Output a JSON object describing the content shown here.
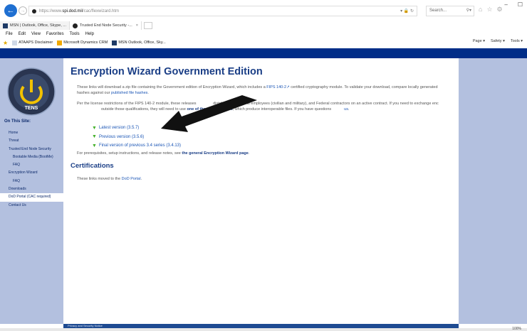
{
  "browser": {
    "url_prefix": "https://www.",
    "url_host": "spi.dod.mil",
    "url_path": "/cac/flexwizard.htm",
    "search_placeholder": "Search...",
    "tabs": [
      {
        "label": "MSN | Outlook, Office, Skype, ..."
      },
      {
        "label": "Trusted End Node Security -..."
      }
    ],
    "menu": [
      "File",
      "Edit",
      "View",
      "Favorites",
      "Tools",
      "Help"
    ],
    "favorites": [
      "ATAAPS Disclaimer",
      "Microsoft Dynamics CRM",
      "MSN Outlook, Office, Sky..."
    ],
    "toolbar_right": [
      "Page ▾",
      "Safety ▾",
      "Tools ▾"
    ],
    "zoom": "100%"
  },
  "sidebar": {
    "heading": "On This Site:",
    "items": [
      {
        "label": "Home"
      },
      {
        "label": "Threat"
      },
      {
        "label": "Trusted End Node Security"
      },
      {
        "label": "Bootable Media (BootMe)"
      },
      {
        "label": "FAQ"
      },
      {
        "label": "Encryption Wizard"
      },
      {
        "label": "FAQ"
      },
      {
        "label": "Downloads"
      },
      {
        "label": "DoD Portal (CAC required)"
      },
      {
        "label": "Contact Us"
      }
    ]
  },
  "main": {
    "title": "Encryption Wizard Government Edition",
    "intro": {
      "t1": "These links will download a zip file containing the Government edition of Encryption Wizard, which includes a ",
      "fips_link": "FIPS 140-2",
      "t2": " certified cryptography module. To validate your download, compare locally generated hashes against our ",
      "hashes_link": "published file hashes",
      "t3": "."
    },
    "license": {
      "t1": "Per the license restrictions of the FIPS 140-2 module, these releases ",
      "t2": "distributed to Federal employees (civilian and military), and Federal contractors on an active contract. If you need to exchange enc",
      "t3": "outside those qualifications, they will need to use ",
      "other_link": "one of the other editions",
      "t4": ", which produce interoperable files. If you have questions",
      "us_link": "us"
    },
    "versions": [
      {
        "label": "Latest version (3.5.7)"
      },
      {
        "label": "Previous version (3.5.6)"
      },
      {
        "label": "Final version of previous 3.4 series (3.4.13)"
      }
    ],
    "prereq": {
      "t1": "For prerequisites, setup instructions, and release notes, see ",
      "link": "the general Encryption Wizard page",
      "t2": "."
    },
    "cert_heading": "Certifications",
    "cert": {
      "t1": "These links moved to the ",
      "link": "DoD Portal",
      "t2": "."
    },
    "footer": "Privacy and Security Notice"
  }
}
